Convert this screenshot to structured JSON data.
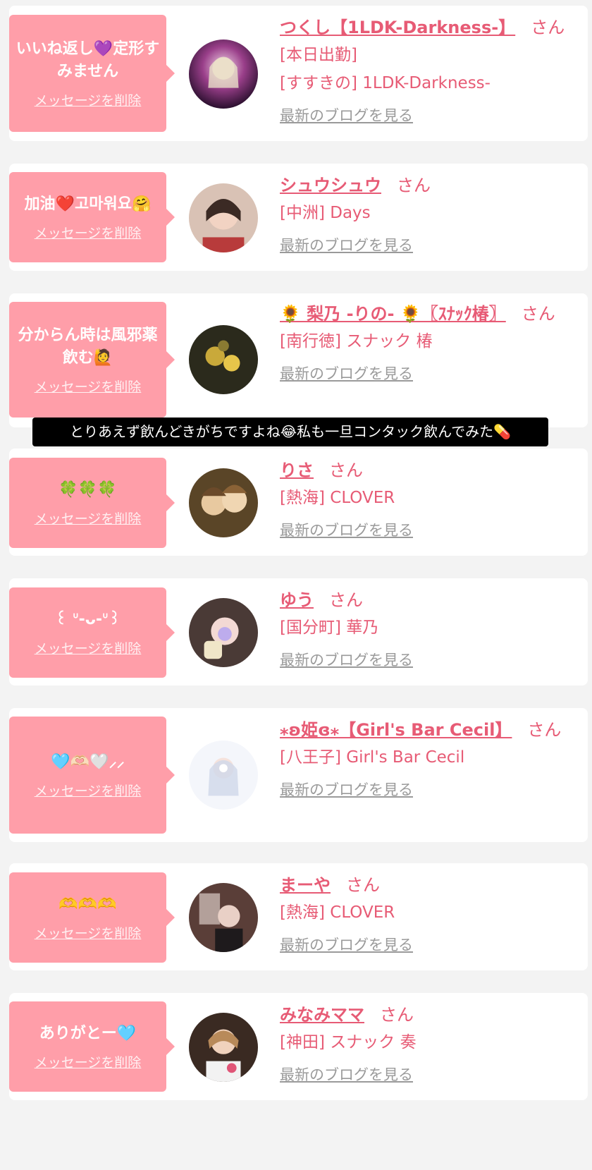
{
  "delete_label": "メッセージを削除",
  "blog_label": "最新のブログを見る",
  "san_label": "さん",
  "caption": "とりあえず飲んどきがちですよね😂私も一旦コンタック飲んでみた💊",
  "colors": {
    "bubble": "#ff9ea9",
    "accent": "#e75b75",
    "link_gray": "#9a9a9a"
  },
  "messages": [
    {
      "bubble": "いいね返し💜定形すみません",
      "name": "つくし【1LDK-Darkness-】",
      "shop": "[本日出勤]",
      "shop2": "[すすきの] 1LDK-Darkness-"
    },
    {
      "bubble": "加油❤️고마워요🤗",
      "name": "シュウシュウ",
      "shop": "[中洲] Days"
    },
    {
      "bubble": "分からん時は風邪薬飲む🙋",
      "name": "🌻 梨乃 -りの- 🌻〖ｽﾅｯｸ椿〗",
      "shop": "[南行徳] スナック 椿"
    },
    {
      "bubble": "🍀🍀🍀",
      "name": "りさ",
      "shop": "[熱海] CLOVER"
    },
    {
      "bubble": "꒰ ᐡ-ᴗ-ᐡ꒱",
      "name": "ゆう",
      "shop": "[国分町] 華乃"
    },
    {
      "bubble": "🩵🫶🏻🤍⸝⸝",
      "name": "⁎ʚ姫ɞ⁎【Girl's Bar Cecil】",
      "shop": "[八王子] Girl's Bar Cecil"
    },
    {
      "bubble": "🫶🫶🫶",
      "name": "まーや",
      "shop": "[熱海] CLOVER"
    },
    {
      "bubble": "ありがとー🩵",
      "name": "みなみママ",
      "shop": "[神田] スナック 奏"
    }
  ]
}
